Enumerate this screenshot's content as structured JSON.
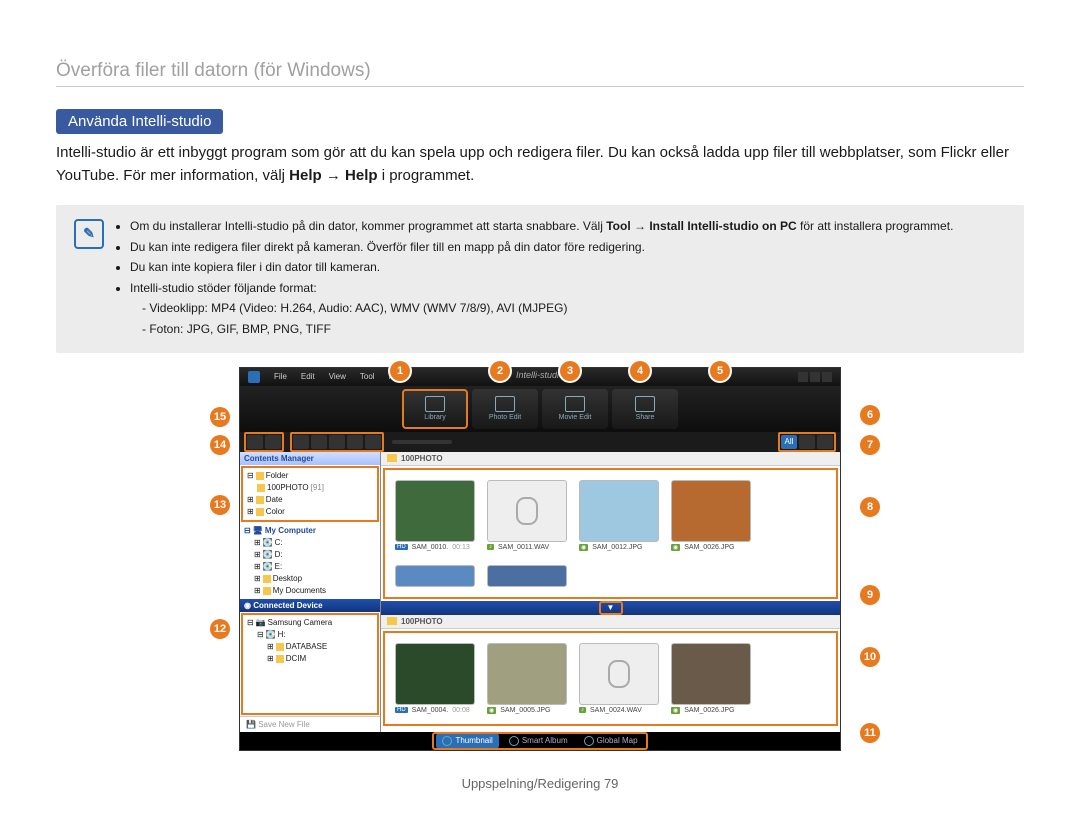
{
  "section_title": "Överföra filer till datorn (för Windows)",
  "sub_badge": "Använda Intelli-studio",
  "intro_html_parts": {
    "p1": "Intelli-studio är ett inbyggt program som gör att du kan spela upp och redigera filer. Du kan också ladda upp filer till webbplatser, som Flickr eller YouTube. För mer information, välj ",
    "help1": "Help",
    "arrow": " → ",
    "help2": "Help",
    "p1_end": " i programmet."
  },
  "note_bullets": {
    "b1_pre": "Om du installerar Intelli-studio på din dator, kommer programmet att starta snabbare. Välj ",
    "b1_tool": "Tool",
    "b1_arrow": " → ",
    "b1_install": "Install Intelli-studio on PC",
    "b1_post": " för att installera programmet.",
    "b2": "Du kan inte redigera filer direkt på kameran. Överför filer till en mapp på din dator före redigering.",
    "b3": "Du kan inte kopiera filer i din dator till kameran.",
    "b4": "Intelli-studio stöder följande format:",
    "b4_sub1": "Videoklipp: MP4 (Video: H.264, Audio: AAC), WMV (WMV 7/8/9), AVI (MJPEG)",
    "b4_sub2": "Foton: JPG, GIF, BMP, PNG, TIFF"
  },
  "callouts": [
    "1",
    "2",
    "3",
    "4",
    "5",
    "6",
    "7",
    "8",
    "9",
    "10",
    "11",
    "12",
    "13",
    "14",
    "15"
  ],
  "app": {
    "title": "Intelli-studio",
    "menus": [
      "File",
      "Edit",
      "View",
      "Tool",
      "Help"
    ],
    "modes": [
      {
        "label": "Library",
        "active": true
      },
      {
        "label": "Photo Edit",
        "active": false
      },
      {
        "label": "Movie Edit",
        "active": false
      },
      {
        "label": "Share",
        "active": false
      }
    ],
    "right_filters": [
      "All",
      "▦",
      "♪"
    ],
    "sidebar": {
      "head1": "Contents Manager",
      "tree1": {
        "folder": "Folder",
        "sub": "100PHOTO",
        "count": "[91]",
        "date": "Date",
        "color": "Color"
      },
      "head_mycomp": "My Computer",
      "drives": [
        "C:",
        "D:",
        "E:",
        "Desktop",
        "My Documents"
      ],
      "head_conn": "Connected Device",
      "device": "Samsung Camera",
      "device_tree": [
        "H:",
        " DATABASE",
        " DCIM"
      ],
      "save_btn": "Save New File"
    },
    "breadcrumb": "100PHOTO",
    "thumbs_top": [
      {
        "name": "SAM_0010.",
        "time": "00:13",
        "badge": "HD",
        "type": "video",
        "bg": "#3f6a3c"
      },
      {
        "name": "SAM_0011.WAV",
        "badge": "♪",
        "type": "audio"
      },
      {
        "name": "SAM_0012.JPG",
        "badge": "◉",
        "type": "photo",
        "bg": "#9ec7e0"
      },
      {
        "name": "SAM_0026.JPG",
        "badge": "◉",
        "type": "photo",
        "bg": "#b66a30"
      }
    ],
    "thumbs_top_row2": [
      {
        "type": "photo",
        "bg": "#5a8ac0"
      },
      {
        "type": "photo",
        "bg": "#4a6fa0"
      }
    ],
    "thumbs_bottom": [
      {
        "name": "SAM_0004.",
        "time": "00:08",
        "badge": "HD",
        "type": "video",
        "bg": "#2a4a2a"
      },
      {
        "name": "SAM_0005.JPG",
        "badge": "◉",
        "type": "photo",
        "bg": "#a0a080"
      },
      {
        "name": "SAM_0024.WAV",
        "badge": "♪",
        "type": "audio"
      },
      {
        "name": "SAM_0026.JPG",
        "badge": "◉",
        "type": "photo",
        "bg": "#6a5a4a"
      }
    ],
    "bottom_tabs": [
      {
        "label": "Thumbnail",
        "active": true
      },
      {
        "label": "Smart Album",
        "active": false
      },
      {
        "label": "Global Map",
        "active": false
      }
    ]
  },
  "footer": {
    "label": "Uppspelning/Redigering",
    "page": "79"
  }
}
